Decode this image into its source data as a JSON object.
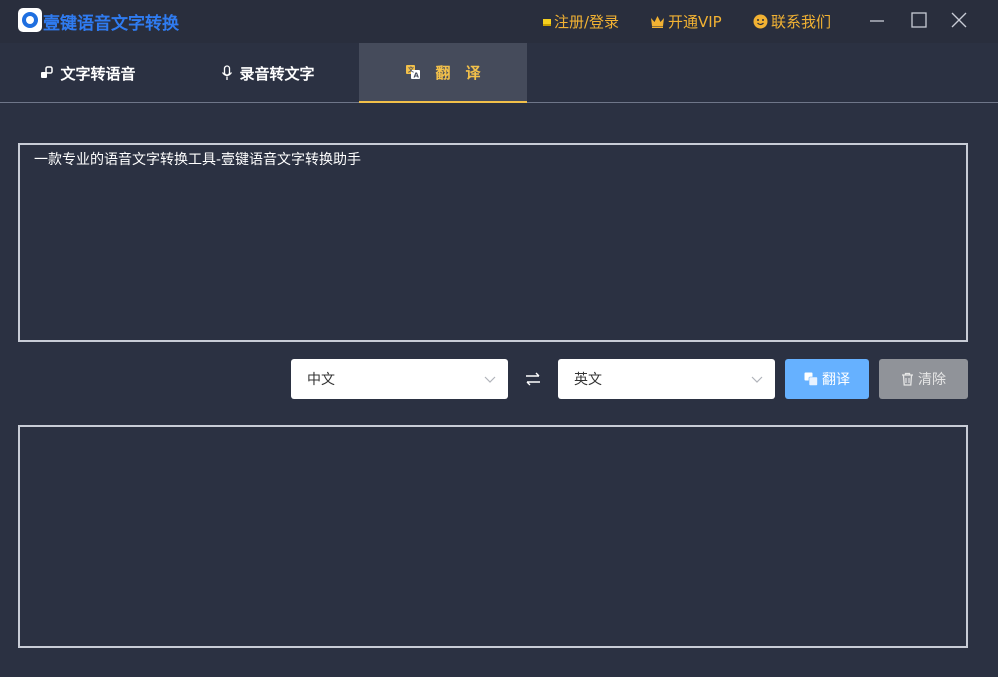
{
  "app": {
    "title": "壹键语音文字转换"
  },
  "header_links": {
    "register_login": "注册/登录",
    "vip": "开通VIP",
    "contact": "联系我们"
  },
  "tabs": [
    {
      "label": "文字转语音",
      "active": false,
      "icon": "shapes-icon"
    },
    {
      "label": "录音转文字",
      "active": false,
      "icon": "microphone-icon"
    },
    {
      "label": "翻　译",
      "active": true,
      "icon": "translate-icon"
    }
  ],
  "source_text": {
    "value": "一款专业的语音文字转换工具-壹键语音文字转换助手"
  },
  "result_text": {
    "value": ""
  },
  "languages": {
    "from": "中文",
    "to": "英文"
  },
  "buttons": {
    "translate": "翻译",
    "clear": "清除"
  },
  "colors": {
    "background": "#2b3142",
    "accent_gold": "#f2c04a",
    "title_blue": "#2f7bf0",
    "translate_button": "#66b1ff",
    "clear_button": "#909399"
  }
}
